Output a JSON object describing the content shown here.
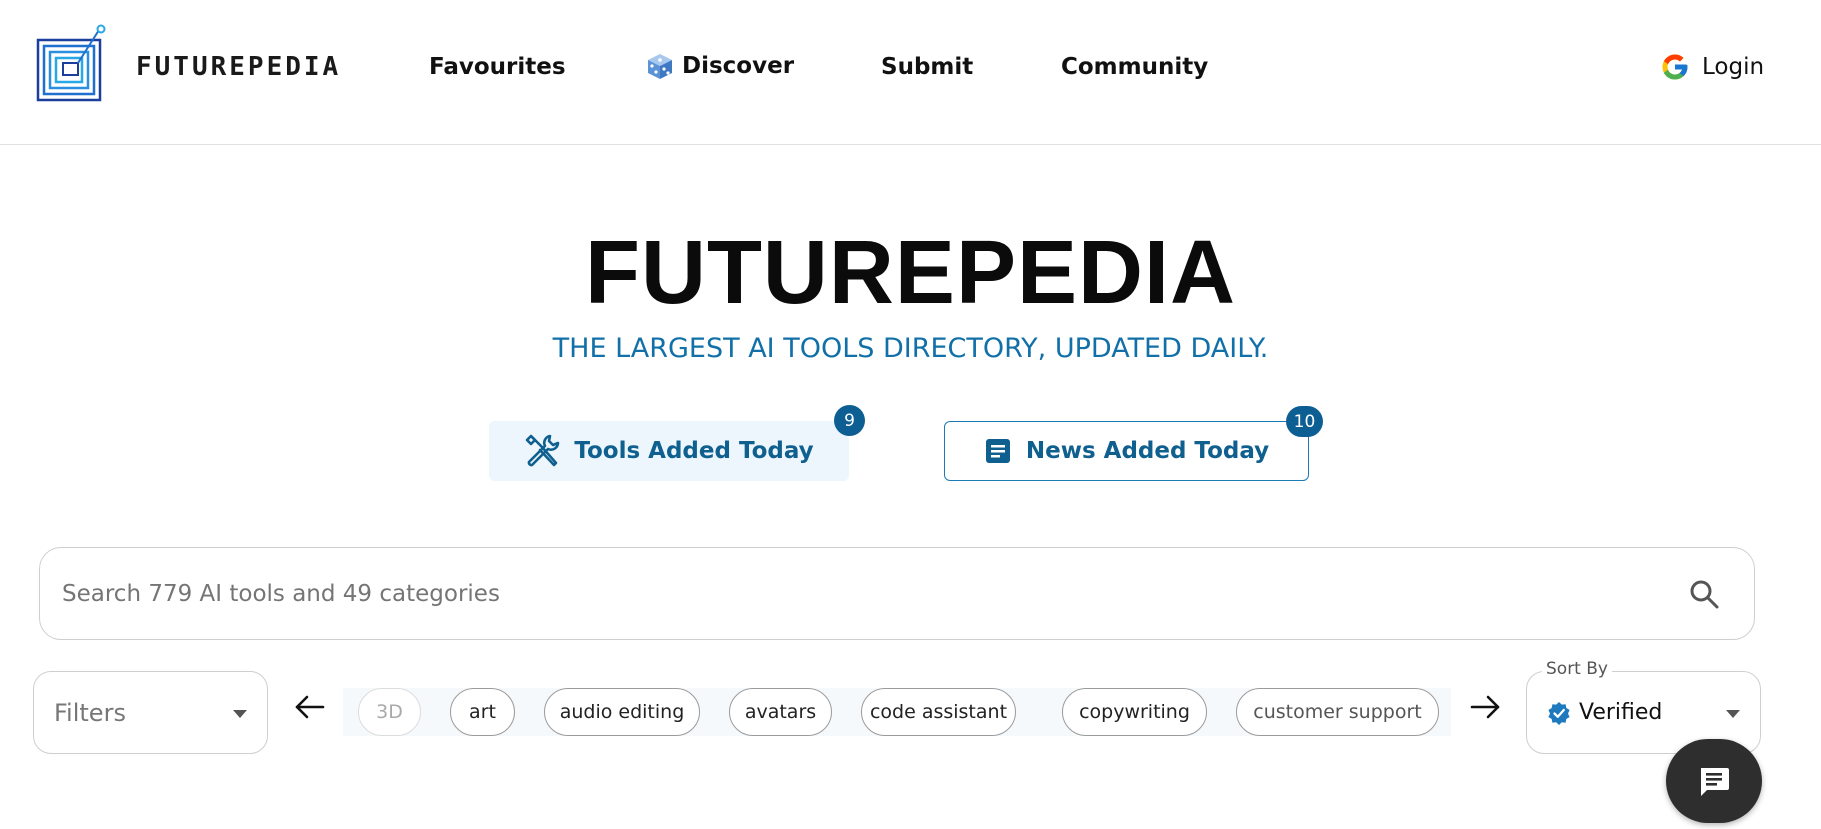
{
  "header": {
    "brand": "FUTUREPEDIA",
    "nav": {
      "favourites": "Favourites",
      "discover": "Discover",
      "submit": "Submit",
      "community": "Community"
    },
    "login": "Login"
  },
  "hero": {
    "title": "FUTUREPEDIA",
    "subtitle": "THE LARGEST AI TOOLS DIRECTORY, UPDATED DAILY.",
    "tools_label": "Tools Added Today",
    "tools_count": "9",
    "news_label": "News Added Today",
    "news_count": "10"
  },
  "search": {
    "placeholder": "Search 779 AI tools and 49 categories"
  },
  "filters": {
    "label": "Filters",
    "tags": [
      "3D",
      "art",
      "audio editing",
      "avatars",
      "code assistant",
      "copywriting",
      "customer support"
    ],
    "sort_label": "Sort By",
    "sort_value": "Verified"
  },
  "colors": {
    "accent": "#1170a8",
    "badge": "#0d5f93",
    "tools_bg": "#ecf6fc"
  },
  "icons": {
    "discover": "dice-icon",
    "login": "google-icon",
    "tools": "tools-icon",
    "news": "document-icon",
    "search": "search-icon",
    "chat": "chat-icon"
  }
}
